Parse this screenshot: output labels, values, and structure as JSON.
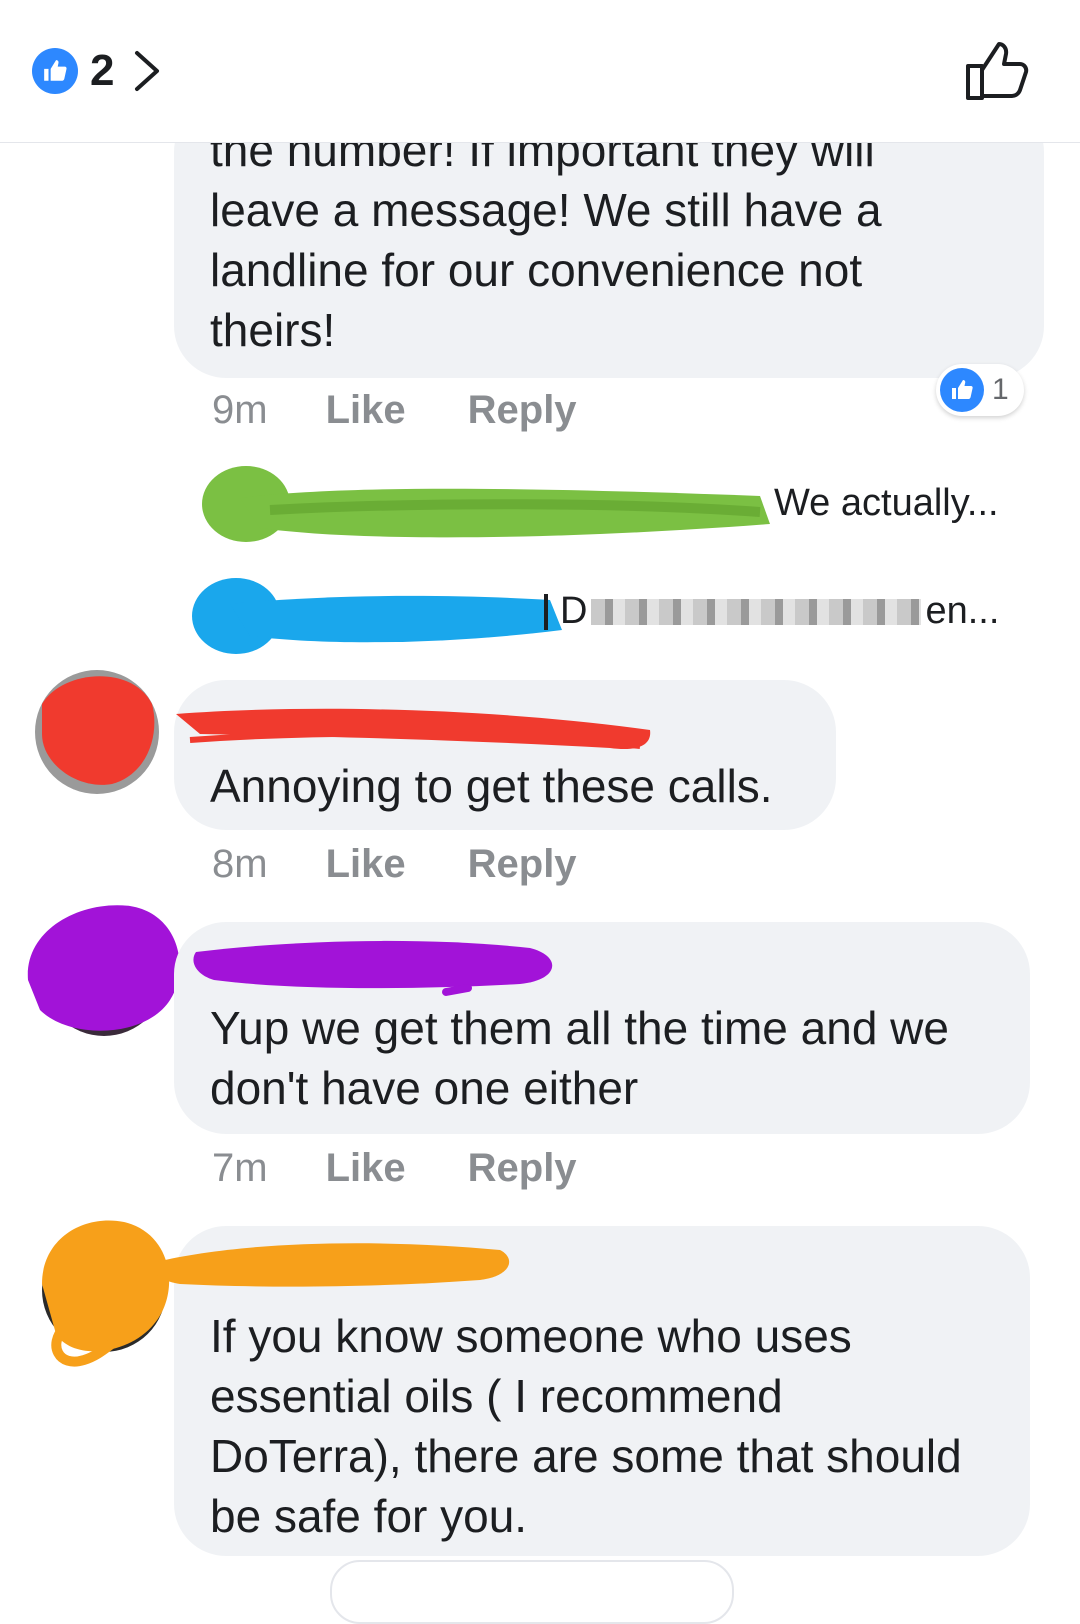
{
  "header": {
    "like_count": "2",
    "icons": [
      "thumbs-up-badge",
      "chevron-right",
      "thumbs-up-outline"
    ]
  },
  "comments": [
    {
      "text": "the number! If important they will\nleave a message! We still have a\nlandline for our convenience not\ntheirs!",
      "time": "9m",
      "like_label": "Like",
      "reply_label": "Reply",
      "reaction_count": "1"
    },
    {
      "text": "Annoying to get these calls.",
      "time": "8m",
      "like_label": "Like",
      "reply_label": "Reply"
    },
    {
      "text": "Yup we get them all the time and we\ndon't have one either",
      "time": "7m",
      "like_label": "Like",
      "reply_label": "Reply"
    },
    {
      "text": "If you know someone who uses\nessential oils ( I recommend\nDoTerra), there are some that should\nbe safe for you."
    }
  ],
  "replies": [
    {
      "preview": "We actually..."
    },
    {
      "preview": "D",
      "preview_end": "en..."
    }
  ],
  "colors": {
    "accent": "#2d88ff",
    "bubble": "#f0f2f5",
    "scribble_green": "#7bc043",
    "scribble_blue": "#1aa7ec",
    "scribble_red": "#f03a2e",
    "scribble_purple": "#a213d8",
    "scribble_orange": "#f7a01a"
  }
}
